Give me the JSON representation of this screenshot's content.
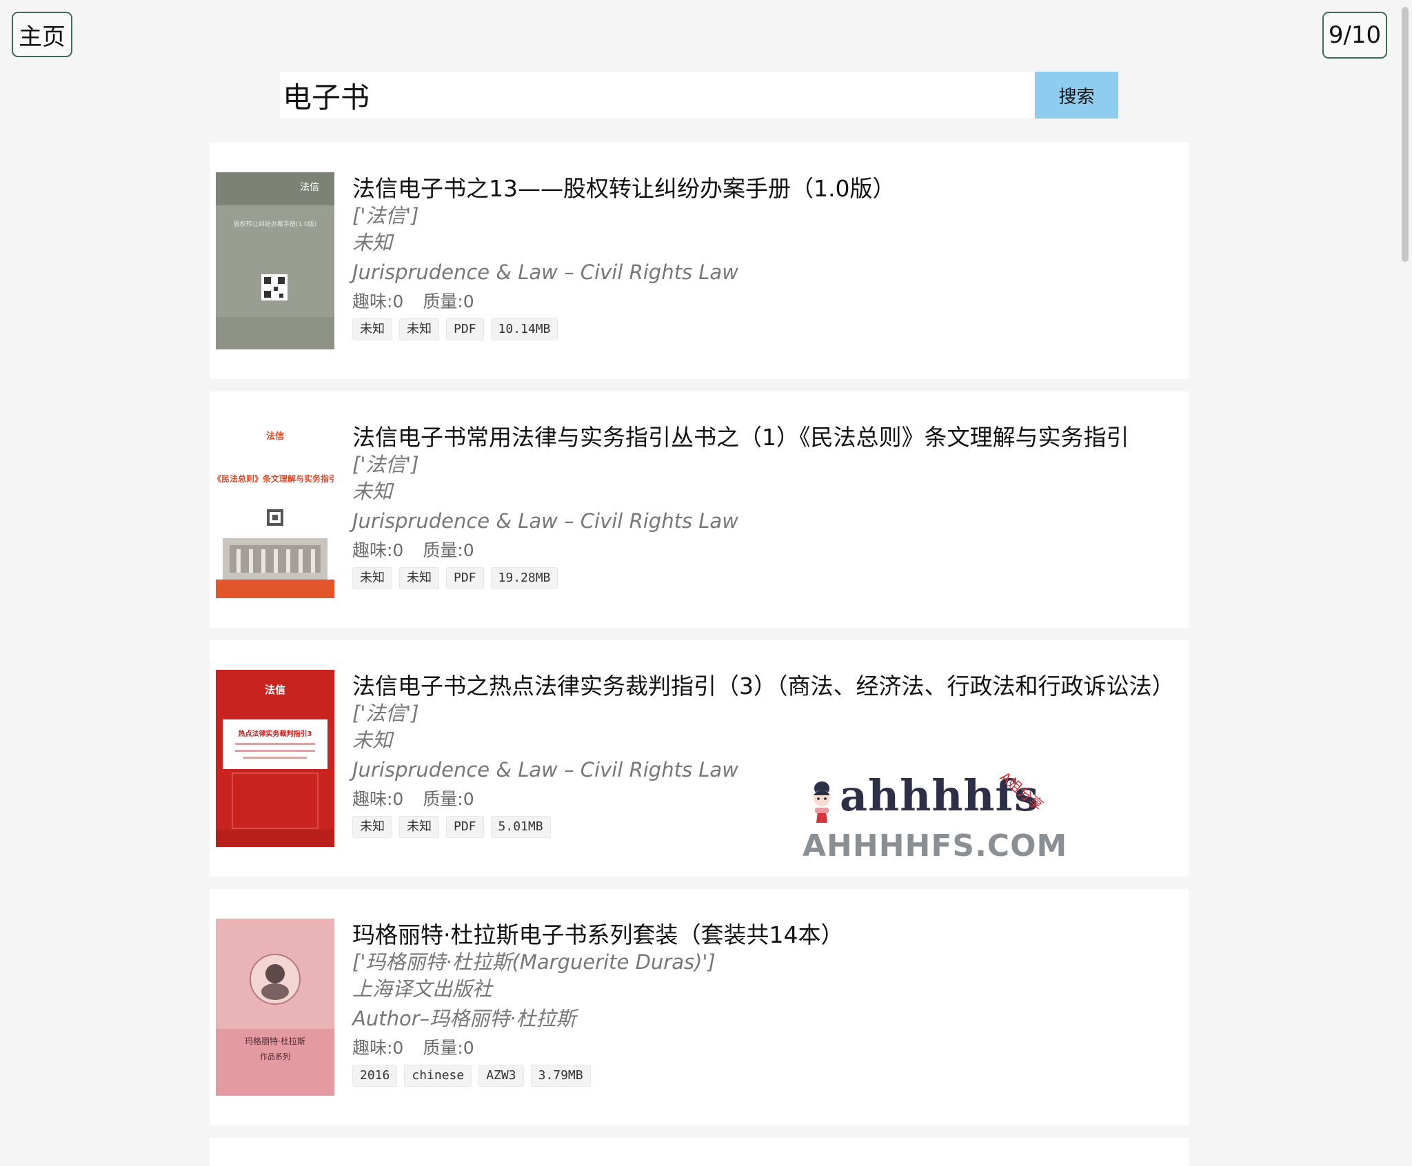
{
  "nav": {
    "home_label": "主页",
    "page_counter": "9/10"
  },
  "search": {
    "query": "电子书",
    "button_label": "搜索"
  },
  "books": [
    {
      "title": "法信电子书之13——股权转让纠纷办案手册（1.0版）",
      "authors": "['法信']",
      "publisher": "未知",
      "category": "Jurisprudence & Law – Civil Rights Law",
      "interest": "趣味:0",
      "quality": "质量:0",
      "tags": [
        "未知",
        "未知",
        "PDF",
        "10.14MB"
      ],
      "cover_text": "法信",
      "cover_subtitle": "股权转让纠纷办案手册(1.0版)"
    },
    {
      "title": "法信电子书常用法律与实务指引丛书之（1）《民法总则》条文理解与实务指引",
      "authors": "['法信']",
      "publisher": "未知",
      "category": "Jurisprudence & Law – Civil Rights Law",
      "interest": "趣味:0",
      "quality": "质量:0",
      "tags": [
        "未知",
        "未知",
        "PDF",
        "19.28MB"
      ],
      "cover_text": "法信",
      "cover_subtitle": "《民法总则》条文理解与实务指引"
    },
    {
      "title": "法信电子书之热点法律实务裁判指引（3）（商法、经济法、行政法和行政诉讼法）",
      "authors": "['法信']",
      "publisher": "未知",
      "category": "Jurisprudence & Law – Civil Rights Law",
      "interest": "趣味:0",
      "quality": "质量:0",
      "tags": [
        "未知",
        "未知",
        "PDF",
        "5.01MB"
      ],
      "cover_text": "法信",
      "cover_subtitle": "热点法律实务裁判指引3"
    },
    {
      "title": "玛格丽特·杜拉斯电子书系列套装（套装共14本）",
      "authors": "['玛格丽特·杜拉斯(Marguerite Duras)']",
      "publisher": "上海译文出版社",
      "category": "Author–玛格丽特·杜拉斯",
      "interest": "趣味:0",
      "quality": "质量:0",
      "tags": [
        "2016",
        "chinese",
        "AZW3",
        "3.79MB"
      ],
      "cover_text": "玛格丽特·杜拉斯",
      "cover_subtitle": "作品系列"
    }
  ],
  "watermark": {
    "script": "ahhhhfs",
    "stamp": "A姐分享",
    "url": "AHHHHFS.COM"
  },
  "colors": {
    "background": "#f4f5f4",
    "card": "#ffffff",
    "search_button": "#8fcdf0",
    "nav_border": "#3f6b52",
    "meta_text": "#777777"
  }
}
